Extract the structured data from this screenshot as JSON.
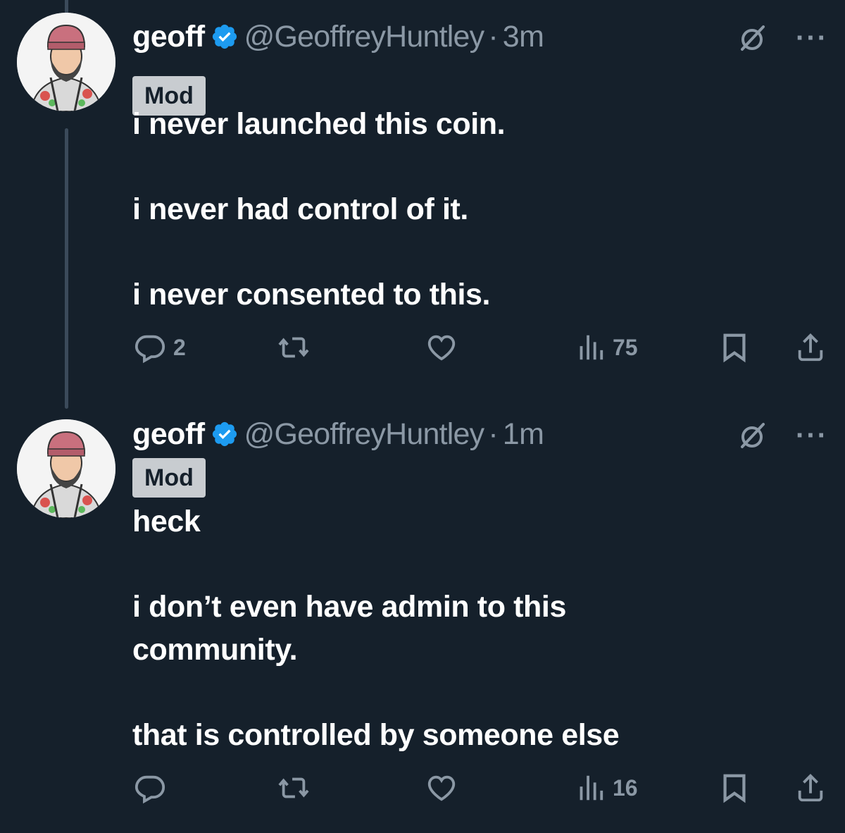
{
  "colors": {
    "background": "#15202b",
    "secondary_text": "#8b98a5",
    "verified_blue": "#1d9bf0",
    "badge_bg": "#c8ccd0"
  },
  "tweets": [
    {
      "name": "geoff",
      "handle": "@GeoffreyHuntley",
      "separator": "·",
      "time": "3m",
      "badge": "Mod",
      "lines": [
        "i never launched this coin.",
        "i never had control of it.",
        "i never consented to this."
      ],
      "replies": "2",
      "views": "75",
      "icons": [
        "grok-icon",
        "more-icon",
        "reply-icon",
        "retweet-icon",
        "like-icon",
        "views-icon",
        "bookmark-icon",
        "share-icon"
      ]
    },
    {
      "name": "geoff",
      "handle": "@GeoffreyHuntley",
      "separator": "·",
      "time": "1m",
      "badge": "Mod",
      "lines": [
        "heck",
        "i don’t even have admin to this",
        "community.",
        "that is controlled by someone else"
      ],
      "replies": "",
      "views": "16",
      "icons": [
        "grok-icon",
        "more-icon",
        "reply-icon",
        "retweet-icon",
        "like-icon",
        "views-icon",
        "bookmark-icon",
        "share-icon"
      ]
    }
  ]
}
